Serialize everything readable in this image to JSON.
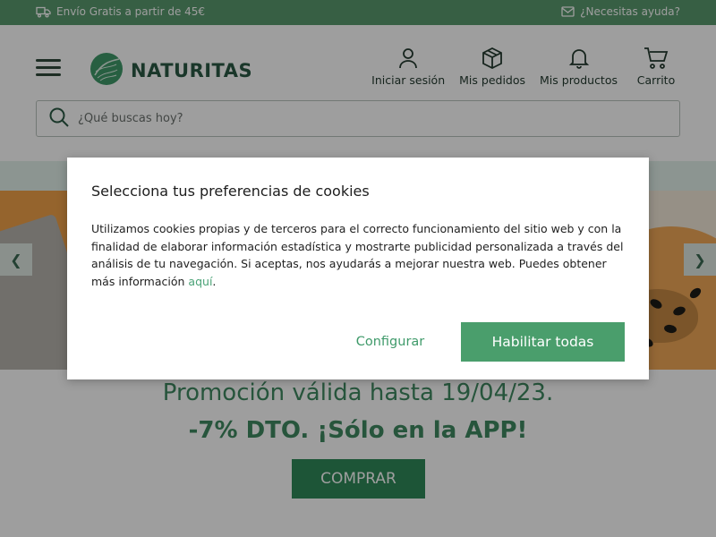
{
  "topbar": {
    "shipping_text": "Envío Gratis a partir de 45€",
    "help_text": "¿Necesitas ayuda?"
  },
  "header": {
    "logo_text": "NATURITAS",
    "nav": {
      "login": "Iniciar sesión",
      "orders": "Mis pedidos",
      "products": "Mis productos",
      "cart": "Carrito"
    },
    "search_placeholder": "¿Qué buscas hoy?"
  },
  "promo": {
    "line1": "Promoción válida hasta 19/04/23.",
    "line2": "-7% DTO. ¡Sólo en la APP!",
    "buy_label": "COMPRAR"
  },
  "cookie_modal": {
    "title": "Selecciona tus preferencias de cookies",
    "body": "Utilizamos cookies propias y de terceros para el correcto funcionamiento del sitio web y con la finalidad de elaborar información estadística y mostrarte publicidad personalizada a través del análisis de tu navegación. Si aceptas, nos ayudarás a mejorar nuestra web. Puedes obtener más información ",
    "link_text": "aquí",
    "body_end": ".",
    "configure_label": "Configurar",
    "enable_all_label": "Habilitar todas"
  },
  "colors": {
    "brand_green": "#5a9a6f",
    "button_green": "#4a9e6c",
    "text_green": "#3f8a62"
  },
  "icons": {
    "shipping": "truck-icon",
    "help": "mail-icon",
    "menu": "hamburger-icon",
    "login": "user-icon",
    "orders": "box-icon",
    "products": "bell-icon",
    "cart": "cart-icon",
    "search": "search-icon",
    "slider_prev": "chevron-left-icon",
    "slider_next": "chevron-right-icon"
  }
}
